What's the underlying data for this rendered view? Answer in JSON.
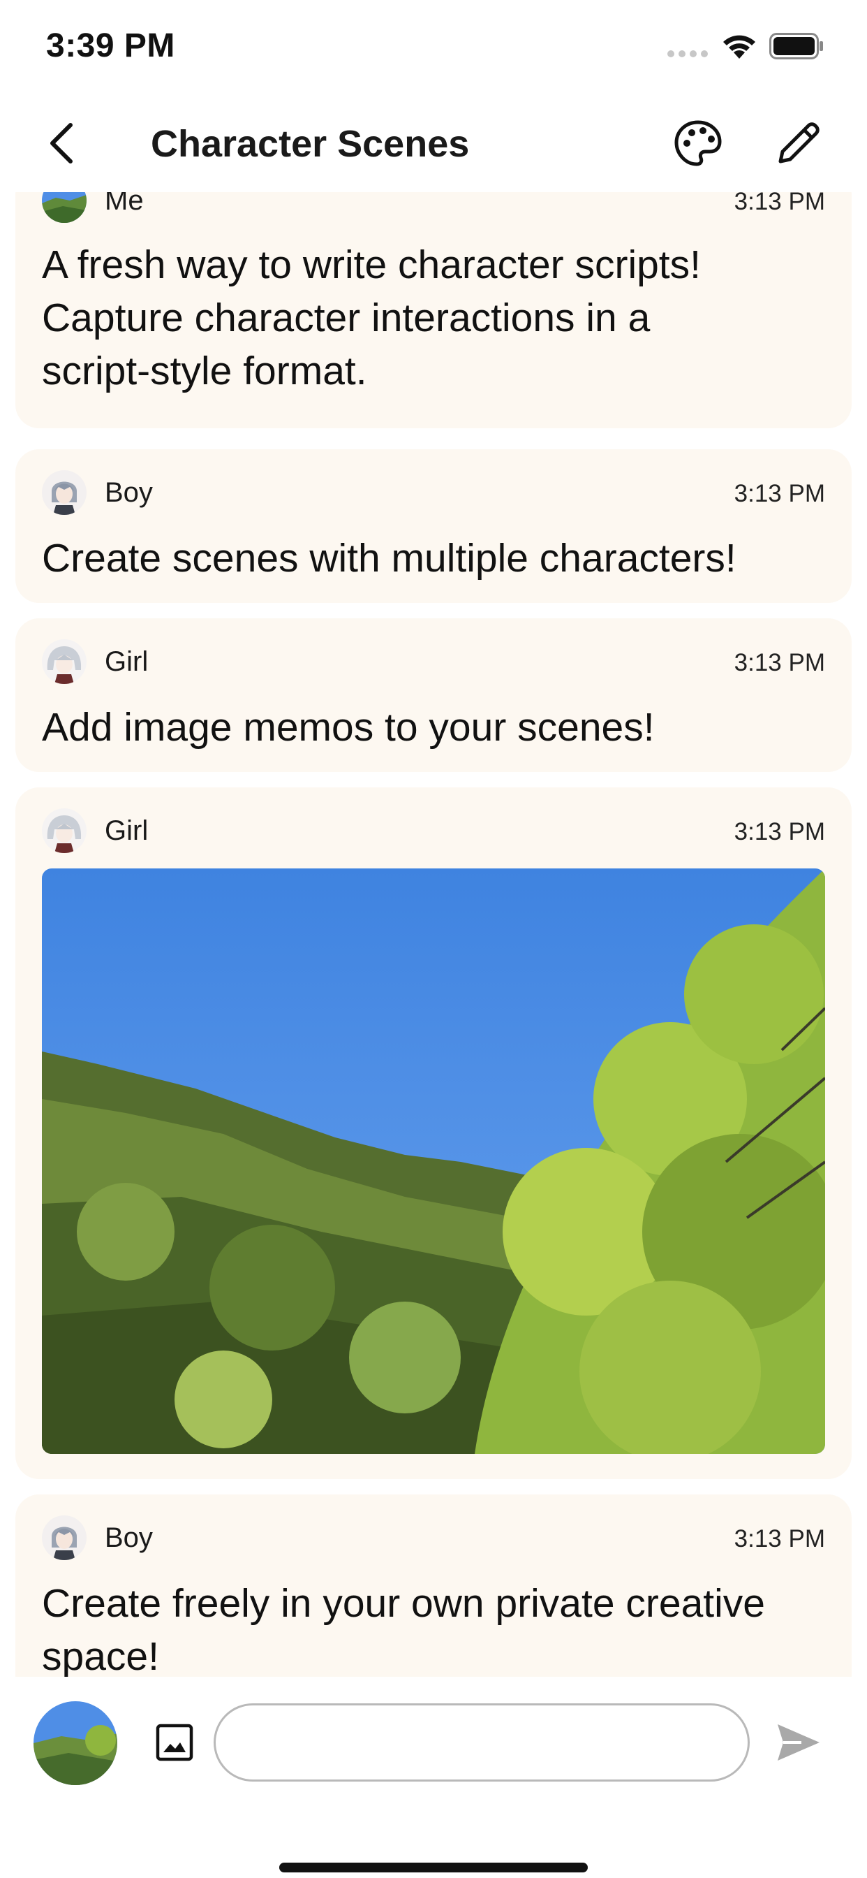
{
  "status_bar": {
    "time": "3:39 PM",
    "wifi_icon": "wifi-icon",
    "battery_icon": "battery-icon"
  },
  "nav": {
    "title": "Character Scenes",
    "back_icon": "chevron-left-icon",
    "palette_icon": "palette-icon",
    "edit_icon": "pencil-icon"
  },
  "messages": [
    {
      "author": "Me",
      "time": "3:13 PM",
      "lines": [
        "A fresh way to write character scripts!",
        "Capture character interactions in a",
        "script-style format."
      ]
    },
    {
      "author": "Boy",
      "time": "3:13 PM",
      "lines": [
        "Create scenes with multiple characters!"
      ]
    },
    {
      "author": "Girl",
      "time": "3:13 PM",
      "lines": [
        "Add image memos to your scenes!"
      ]
    },
    {
      "author": "Girl",
      "time": "3:13 PM",
      "image": "photo of a forested hillside under a blue sky"
    },
    {
      "author": "Boy",
      "time": "3:13 PM",
      "lines": [
        "Create freely in your own private creative",
        "space!"
      ]
    }
  ],
  "input_bar": {
    "placeholder": "",
    "image_icon": "image-icon",
    "send_icon": "send-icon"
  },
  "colors": {
    "card_background": "#fdf8f1",
    "sky": "#4f8ee6",
    "send_icon": "#a9a9a9"
  }
}
